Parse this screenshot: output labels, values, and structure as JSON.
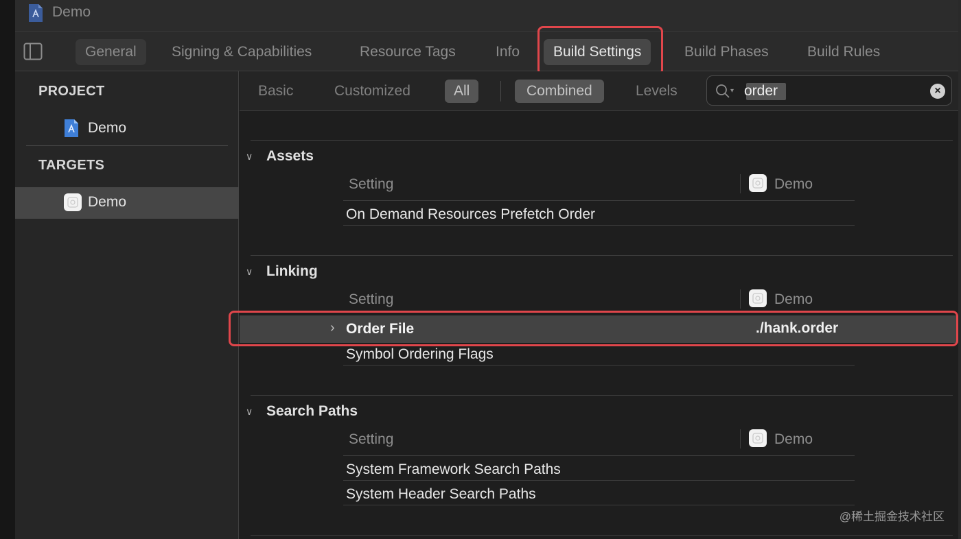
{
  "window": {
    "title": "Demo"
  },
  "tabs": [
    {
      "label": "General"
    },
    {
      "label": "Signing & Capabilities"
    },
    {
      "label": "Resource Tags"
    },
    {
      "label": "Info"
    },
    {
      "label": "Build Settings",
      "active": true
    },
    {
      "label": "Build Phases"
    },
    {
      "label": "Build Rules"
    }
  ],
  "sidebar": {
    "project_header": "PROJECT",
    "project_item": "Demo",
    "targets_header": "TARGETS",
    "target_item": "Demo"
  },
  "filter": {
    "basic": "Basic",
    "customized": "Customized",
    "all": "All",
    "combined": "Combined",
    "levels": "Levels",
    "search_value": "order"
  },
  "sections": [
    {
      "title": "Assets",
      "column_setting": "Setting",
      "column_target": "Demo",
      "rows": [
        {
          "label": "On Demand Resources Prefetch Order"
        }
      ]
    },
    {
      "title": "Linking",
      "column_setting": "Setting",
      "column_target": "Demo",
      "rows": [
        {
          "label": "Order File",
          "value": "./hank.order",
          "selected": true
        },
        {
          "label": "Symbol Ordering Flags"
        }
      ]
    },
    {
      "title": "Search Paths",
      "column_setting": "Setting",
      "column_target": "Demo",
      "rows": [
        {
          "label": "System Framework Search Paths"
        },
        {
          "label": "System Header Search Paths"
        }
      ]
    }
  ],
  "watermark": "@稀土掘金技术社区",
  "colors": {
    "highlight": "#e0464b",
    "selected_row": "#434343",
    "background": "#1e1e1e"
  },
  "icons": [
    "xcode-project-file-icon",
    "sidebar-toggle-icon",
    "app-target-icon",
    "search-icon",
    "clear-icon",
    "disclosure-chevron-icon"
  ]
}
